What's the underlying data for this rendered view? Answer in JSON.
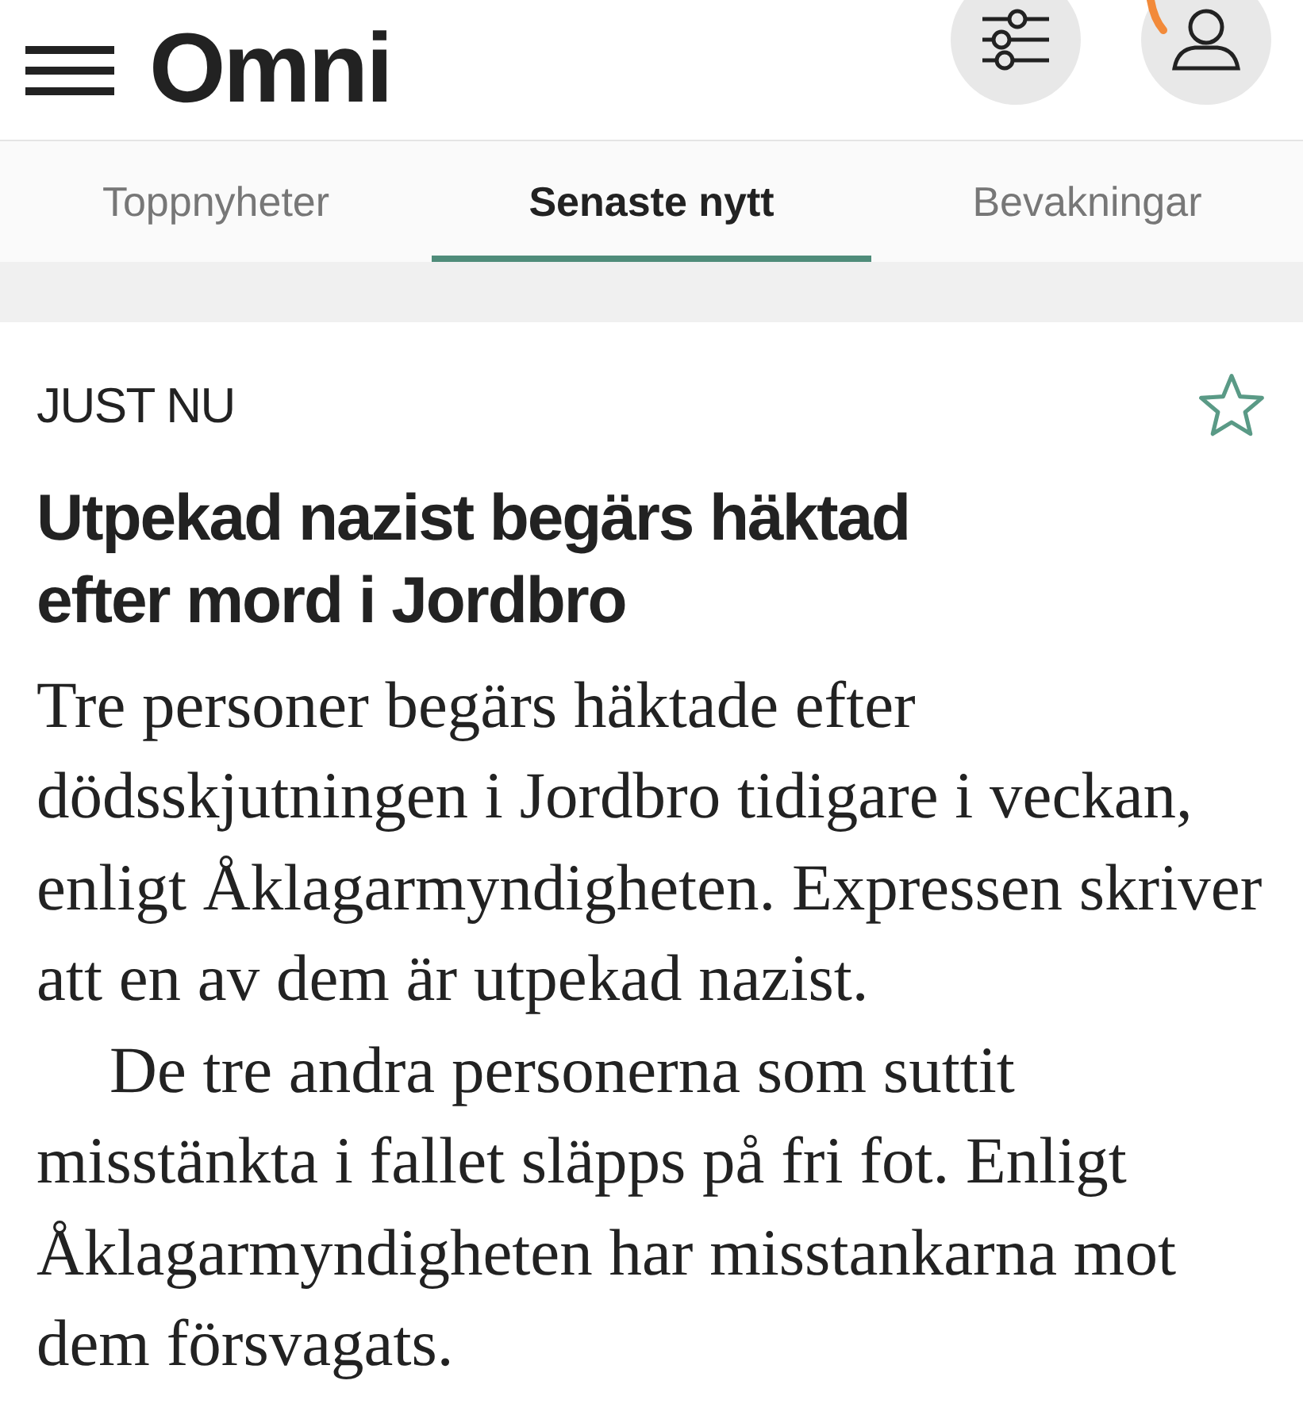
{
  "header": {
    "logo": "Omni"
  },
  "tabs": [
    {
      "label": "Toppnyheter",
      "selected": false
    },
    {
      "label": "Senaste nytt",
      "selected": true
    },
    {
      "label": "Bevakningar",
      "selected": false
    }
  ],
  "article": {
    "label": "JUST NU",
    "starred": false,
    "headline": "Utpekad nazist begärs häktad efter mord i Jordbro",
    "paragraphs": [
      "Tre personer begärs häktade efter dödsskjutningen i Jordbro tidigare i veckan, enligt Åklagarmyndigheten. Expressen skriver att en av dem är utpekad nazist.",
      "De tre andra personerna som suttit misstänkta i fallet släpps på fri fot. Enligt Åklagarmyndigheten har misstankarna mot dem försvagats."
    ]
  }
}
